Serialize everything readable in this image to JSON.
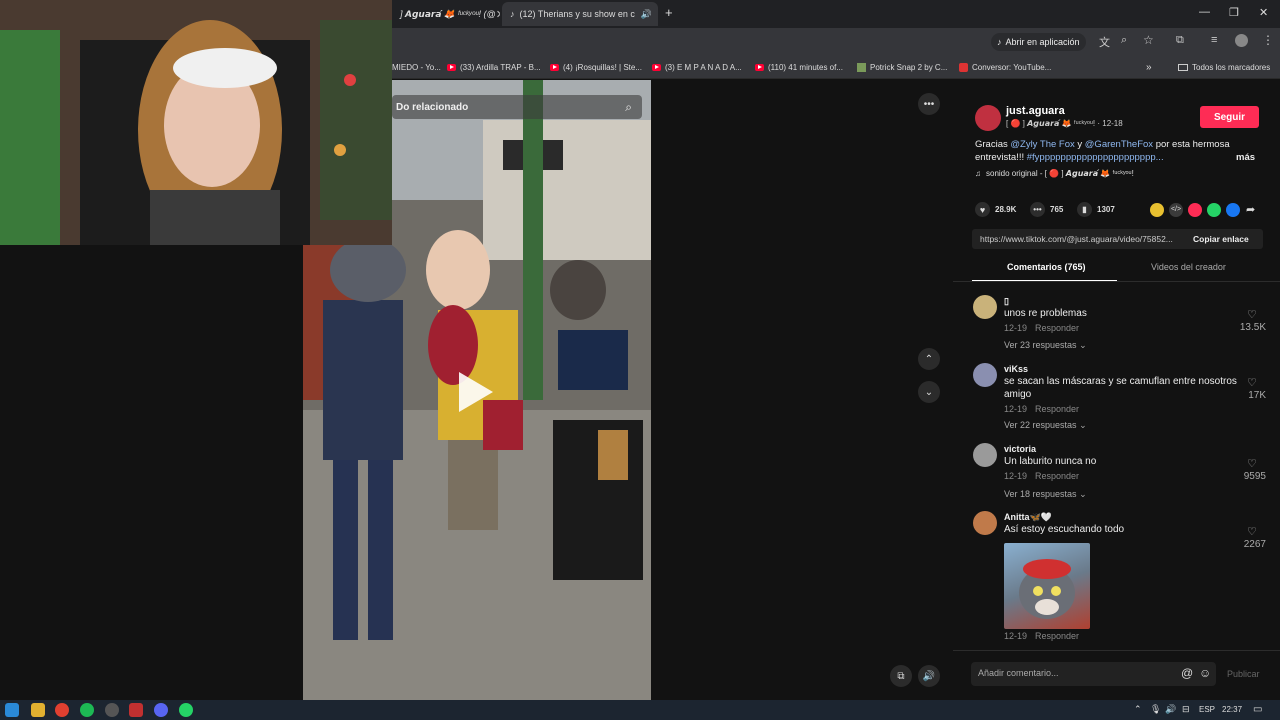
{
  "browser": {
    "tabs": [
      {
        "title": "] 𝘼𝙜𝙪𝙖𝙧𝙖́ 🦊 ᶠᵘᶜᵏʸᵒᵘ! (@"
      },
      {
        "title": "(12) Therians y su show en c"
      }
    ],
    "new_tab": "+",
    "toolbar": {
      "open_in_app": "Abrir en aplicación"
    },
    "bookmarks": [
      "MIEDO - Yo...",
      "(33) Ardilla TRAP - B...",
      "(4) ¡Rosquillas! | Ste...",
      "(3) E M P A N A D A...",
      "(110) 41 minutes of...",
      "Potrick Snap 2 by C...",
      "Conversor: YouTube..."
    ],
    "all_bookmarks": "Todos los marcadores"
  },
  "video": {
    "related_label": "Do relacionado",
    "more_icon": "more-icon"
  },
  "post": {
    "username": "just.aguara",
    "display": "[ 🔴 ] 𝘼𝙜𝙪𝙖𝙧𝙖́ 🦊 ᶠᵘᶜᵏʸᵒᵘ! · 12-18",
    "follow": "Seguir",
    "caption_1": "Gracias",
    "mention_1": "@Zyly The Fox",
    "caption_2": "y",
    "mention_2": "@GarenTheFox",
    "caption_3": "por esta hermosa",
    "caption_4": "entrevista!!!",
    "hashtag": "#fypppppppppppppppppppppp...",
    "more": "más",
    "sound": "sonido original - [ 🔴 ] 𝘼𝙜𝙪𝙖𝙧𝙖́ 🦊 ᶠᵘᶜᵏʸᵒᵘ!",
    "likes": "28.9K",
    "comments": "765",
    "saves": "1307",
    "url": "https://www.tiktok.com/@just.aguara/video/75852...",
    "copy_link": "Copiar enlace",
    "tab_comments": "Comentarios (765)",
    "tab_creator": "Videos del creador"
  },
  "comments": [
    {
      "name": "▯",
      "text": "unos re problemas",
      "date": "12-19",
      "reply": "Responder",
      "replies": "Ver 23 respuestas",
      "likes": "13.5K",
      "avatar_color": "#c9b27a"
    },
    {
      "name": "viKss",
      "text": "se sacan las máscaras y se camuflan entre nosotros",
      "text2": "amigo",
      "date": "12-19",
      "reply": "Responder",
      "replies": "Ver 22 respuestas",
      "likes": "17K",
      "avatar_color": "#8a8fb0"
    },
    {
      "name": "victoria",
      "text": "Un laburito nunca no",
      "date": "12-19",
      "reply": "Responder",
      "replies": "Ver 18 respuestas",
      "likes": "9595",
      "avatar_color": "#9a9a9a"
    },
    {
      "name": "Anitta🦋🤍",
      "text": "Así estoy escuchando todo",
      "date": "12-19",
      "reply": "Responder",
      "likes": "2267",
      "avatar_color": "#c07a4a"
    }
  ],
  "composer": {
    "placeholder": "Añadir comentario...",
    "publish": "Publicar"
  },
  "taskbar": {
    "lang": "ESP",
    "time": "22:37"
  },
  "colors": {
    "follow_red": "#fe2c55",
    "mention_blue": "#8fb8f0"
  }
}
